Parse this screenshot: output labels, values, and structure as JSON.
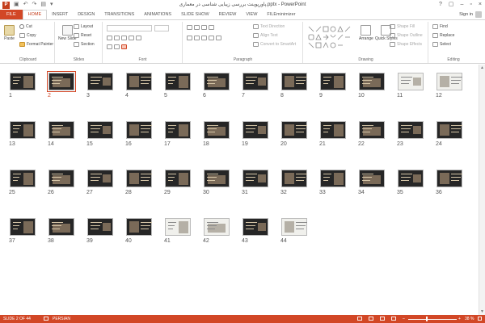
{
  "title_bar": {
    "logo_letter": "P",
    "undo_icon": "undo-icon",
    "redo_icon": "redo-icon",
    "window_title": "پاورپوینت بررسی زیبایی شناسی در معماری.pptx - PowerPoint",
    "controls": [
      "?",
      "▢",
      "–",
      "▫",
      "×"
    ]
  },
  "tabs": [
    {
      "label": "FILE"
    },
    {
      "label": "HOME"
    },
    {
      "label": "INSERT"
    },
    {
      "label": "DESIGN"
    },
    {
      "label": "TRANSITIONS"
    },
    {
      "label": "ANIMATIONS"
    },
    {
      "label": "SLIDE SHOW"
    },
    {
      "label": "REVIEW"
    },
    {
      "label": "VIEW"
    },
    {
      "label": "FILEminimizer"
    }
  ],
  "active_tab": "HOME",
  "signin": "Sign in",
  "ribbon": {
    "clipboard": {
      "label": "Clipboard",
      "paste": "Paste",
      "cut": "Cut",
      "copy": "Copy",
      "format_painter": "Format Painter"
    },
    "slides": {
      "label": "Slides",
      "new_slide": "New Slide",
      "layout": "Layout",
      "reset": "Reset",
      "section": "Section"
    },
    "font": {
      "label": "Font"
    },
    "paragraph": {
      "label": "Paragraph",
      "text_direction": "Text Direction",
      "align_text": "Align Text",
      "convert_smartart": "Convert to SmartArt"
    },
    "drawing": {
      "label": "Drawing",
      "arrange": "Arrange",
      "quick_styles": "Quick Styles",
      "shape_fill": "Shape Fill",
      "shape_outline": "Shape Outline",
      "shape_effects": "Shape Effects"
    },
    "editing": {
      "label": "Editing",
      "find": "Find",
      "replace": "Replace",
      "select": "Select"
    }
  },
  "slides": {
    "total": 44,
    "selected": 2,
    "light_slides": [
      11,
      12,
      41,
      42,
      44
    ]
  },
  "status": {
    "slide_info": "SLIDE 2 OF 44",
    "language": "PERSIAN",
    "zoom": "38 %",
    "zoom_level": 0.38
  }
}
